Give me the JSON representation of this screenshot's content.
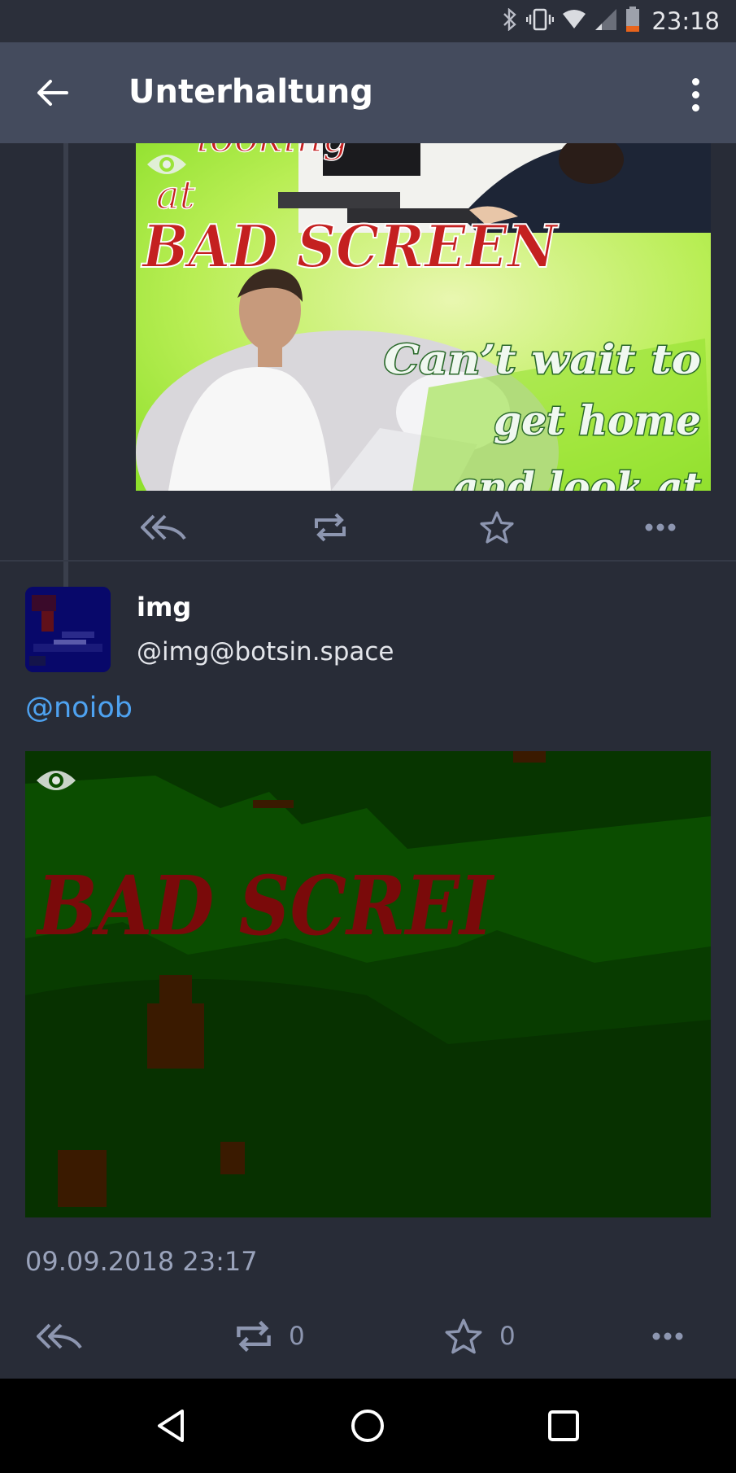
{
  "status_bar": {
    "time": "23:18",
    "icons": [
      "bluetooth-icon",
      "vibrate-icon",
      "wifi-icon",
      "signal-icon",
      "battery-icon"
    ],
    "battery_color": "#e8641c"
  },
  "app_bar": {
    "title": "Unterhaltung",
    "icons": [
      "arrow-left-icon",
      "more-vertical-icon"
    ]
  },
  "previous_post": {
    "media": {
      "caption_lines": [
        "looking",
        "at",
        "BAD SCREEN",
        "Can’t wait to",
        "get home",
        "and look at"
      ],
      "icons": [
        "eye-icon"
      ]
    },
    "actions": [
      "reply-all-icon",
      "boost-icon",
      "star-icon",
      "more-horizontal-icon"
    ]
  },
  "post": {
    "display_name": "img",
    "account": "@img@botsin.space",
    "mention": "@noiob",
    "media": {
      "caption": "BAD SCREI",
      "icons": [
        "eye-icon"
      ]
    },
    "timestamp": "09.09.2018 23:17",
    "boost_count": "0",
    "favourite_count": "0",
    "actions": [
      "reply-all-icon",
      "boost-icon",
      "star-icon",
      "more-horizontal-icon"
    ]
  },
  "colors": {
    "background": "#282c37",
    "app_bar": "#444b5d",
    "mention": "#4ea2f0",
    "icon": "#8d96b0",
    "timestamp": "#9aa3bb"
  },
  "navigation_bar": {
    "icons": [
      "back-triangle-icon",
      "home-circle-icon",
      "recents-square-icon"
    ]
  }
}
